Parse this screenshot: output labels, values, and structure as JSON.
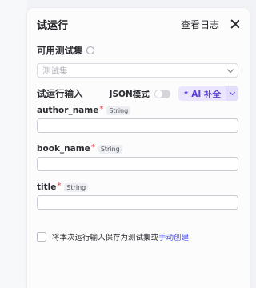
{
  "panel": {
    "title": "试运行",
    "view_log": "查看日志"
  },
  "test_set": {
    "label": "可用测试集",
    "info_icon": "i",
    "placeholder": "测试集"
  },
  "run_input": {
    "label": "试运行输入",
    "json_mode_label": "JSON模式",
    "json_mode_on": false,
    "ai_button_icon": "✦",
    "ai_button_label": "AI 补全"
  },
  "fields": [
    {
      "name": "author_name",
      "required": "*",
      "type": "String",
      "value": ""
    },
    {
      "name": "book_name",
      "required": "*",
      "type": "String",
      "value": ""
    },
    {
      "name": "title",
      "required": "*",
      "type": "String",
      "value": ""
    }
  ],
  "save_option": {
    "checked": false,
    "text": "将本次运行输入保存为测试集或",
    "link": "手动创建"
  },
  "colors": {
    "accent": "#4d53e8",
    "ai_purple": "#5b3fd6",
    "required": "#e5333d"
  }
}
